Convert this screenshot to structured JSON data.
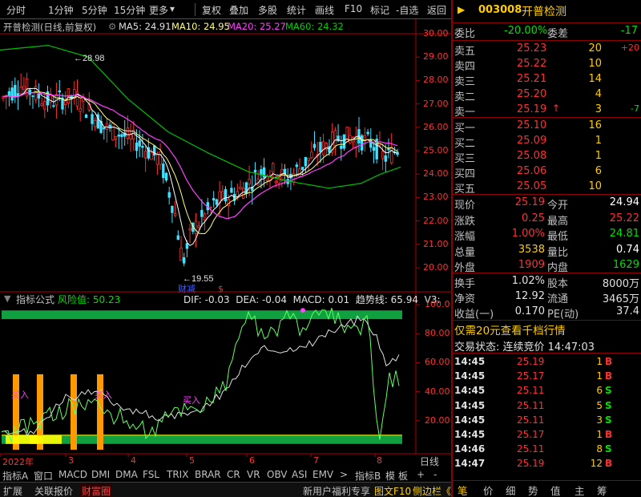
{
  "menu": [
    "分时",
    "1分钟",
    "5分钟",
    "15分钟",
    "更多",
    "复权",
    "叠加",
    "多股",
    "统计",
    "画线",
    "F10",
    "标记",
    "-自选",
    "返回"
  ],
  "title": {
    "stock": "开普检测(日线,前复权)",
    "ma5": "MA5: 24.91",
    "ma10": "MA10: 24.95",
    "ma20": "MA20: 25.27",
    "ma60": "MA60: 24.32"
  },
  "price_axis": [
    "30.00",
    "29.00",
    "28.00",
    "27.00",
    "26.00",
    "25.00",
    "24.00",
    "23.00",
    "22.00",
    "21.00",
    "20.00"
  ],
  "annotations": {
    "high": "28.98",
    "low": "19.55",
    "low_label": "财减",
    "low_mark": "$"
  },
  "indicator": {
    "name": "指标公式",
    "risk": "风险值: 50.23",
    "values": "DIF: -0.03  DEA: -0.04  MACD: 0.01  趋势线: 65.94  V3:",
    "axis": [
      "100.0",
      "80.00",
      "60.00",
      "40.00",
      "20.00"
    ],
    "buy_label": "买入"
  },
  "months": [
    "2022年",
    "3",
    "4",
    "5",
    "6",
    "7",
    "8"
  ],
  "tabs": [
    "指标A",
    "窗口",
    "MACD",
    "DMI",
    "DMA",
    "FSL",
    "TRIX",
    "BRAR",
    "CR",
    "VR",
    "OBV",
    "ASI",
    "EMV",
    "指标B",
    "模",
    "板",
    "+",
    "-",
    "日线"
  ],
  "bottom": [
    "扩展",
    "关联报价",
    "财富圈",
    "新用户福利专享",
    "图文F10",
    "侧边栏《"
  ],
  "quote": {
    "code": "003008",
    "name": "开普检测",
    "weibi_label": "委比",
    "weibi": "-20.00%",
    "weicha_label": "委差",
    "weicha": "-17",
    "asks": [
      {
        "label": "卖五",
        "price": "25.23",
        "vol": "20",
        "chg": "+20"
      },
      {
        "label": "卖四",
        "price": "25.22",
        "vol": "10",
        "chg": ""
      },
      {
        "label": "卖三",
        "price": "25.21",
        "vol": "14",
        "chg": ""
      },
      {
        "label": "卖二",
        "price": "25.20",
        "vol": "4",
        "chg": ""
      },
      {
        "label": "卖一",
        "price": "25.19",
        "vol": "3",
        "chg": "-7"
      }
    ],
    "bids": [
      {
        "label": "买一",
        "price": "25.10",
        "vol": "16"
      },
      {
        "label": "买二",
        "price": "25.09",
        "vol": "1"
      },
      {
        "label": "买三",
        "price": "25.08",
        "vol": "1"
      },
      {
        "label": "买四",
        "price": "25.06",
        "vol": "6"
      },
      {
        "label": "买五",
        "price": "25.05",
        "vol": "10"
      }
    ],
    "stats": [
      {
        "l1": "现价",
        "v1": "25.19",
        "l2": "今开",
        "v2": "24.94"
      },
      {
        "l1": "涨跌",
        "v1": "0.25",
        "l2": "最高",
        "v2": "25.22"
      },
      {
        "l1": "涨幅",
        "v1": "1.00%",
        "l2": "最低",
        "v2": "24.81"
      },
      {
        "l1": "总量",
        "v1": "3538",
        "l2": "量比",
        "v2": "0.74"
      },
      {
        "l1": "外盘",
        "v1": "1909",
        "l2": "内盘",
        "v2": "1629"
      }
    ],
    "fund": [
      {
        "l1": "换手",
        "v1": "1.02%",
        "l2": "股本",
        "v2": "8000万"
      },
      {
        "l1": "净资",
        "v1": "12.92",
        "l2": "流通",
        "v2": "3465万"
      },
      {
        "l1": "收益(一)",
        "v1": "0.170",
        "l2": "PE(动)",
        "v2": "37.4"
      }
    ],
    "promo": "仅需20元查看千档行情",
    "status": "交易状态: 连续竞价  14:47:03",
    "ticks": [
      {
        "t": "14:45",
        "p": "25.19",
        "v": "1",
        "d": "B"
      },
      {
        "t": "14:45",
        "p": "25.17",
        "v": "1",
        "d": "B"
      },
      {
        "t": "14:45",
        "p": "25.11",
        "v": "6",
        "d": "S"
      },
      {
        "t": "14:45",
        "p": "25.11",
        "v": "5",
        "d": "S"
      },
      {
        "t": "14:45",
        "p": "25.11",
        "v": "3",
        "d": "S"
      },
      {
        "t": "14:45",
        "p": "25.17",
        "v": "1",
        "d": "B"
      },
      {
        "t": "14:46",
        "p": "25.11",
        "v": "8",
        "d": "S"
      },
      {
        "t": "14:47",
        "p": "25.19",
        "v": "12",
        "d": "B"
      }
    ],
    "bottom_tabs": [
      "笔",
      "价",
      "细",
      "势",
      "值",
      "主",
      "筹"
    ]
  },
  "colors": {
    "red": "#ff3030",
    "green": "#00e000",
    "yellow": "#ffff00",
    "ma10": "#ffff80",
    "ma20": "#ff40ff",
    "ma60": "#00c000",
    "axis": "#b00000"
  }
}
